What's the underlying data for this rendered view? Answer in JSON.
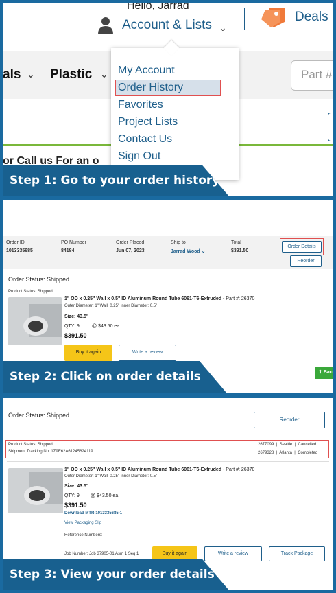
{
  "steps": {
    "step1": {
      "num": "Step 1:",
      "text": "Go to your order history"
    },
    "step2": {
      "num": "Step 2:",
      "text": "Click on order details"
    },
    "step3": {
      "num": "Step 3:",
      "text": "View your order details"
    }
  },
  "header": {
    "greeting": "Hello, Jarrad",
    "account_label": "Account & Lists",
    "deals_label": "Deals"
  },
  "nav": {
    "item_partial": "als",
    "item_plastic": "Plastic",
    "search_placeholder": "Part #,",
    "call_text": "or Call us For an o"
  },
  "account_menu": {
    "items": [
      "My Account",
      "Order History",
      "Favorites",
      "Project Lists",
      "Contact Us",
      "Sign Out"
    ]
  },
  "order": {
    "order_id_label": "Order ID",
    "order_id": "1013335685",
    "po_label": "PO Number",
    "po": "84184",
    "placed_label": "Order Placed",
    "placed": "Jun 07, 2023",
    "ship_label": "Ship to",
    "ship": "Jarrad Wood",
    "total_label": "Total",
    "total": "$391.50",
    "details_btn": "Order Details",
    "reorder_btn": "Reorder",
    "status_title": "Order Status: Shipped",
    "product_status": "Product Status: Shipped",
    "product_title": "1\" OD x 0.25\" Wall x 0.5\" ID Aluminum Round Tube 6061-T6-Extruded",
    "part_number": "- Part #: 26370",
    "specs": "Outer Diameter: 1\"   Wall: 0.25\"   Inner Diameter: 0.5\"",
    "size": "Size:  43.5\"",
    "qty": "QTY: 9",
    "unit_price": "@ $43.50 ea.",
    "unit_price2": "@ $43.50 ea",
    "line_total": "$391.50",
    "buy_again": "Buy it again",
    "write_review": "Write a review",
    "track_package": "Track Package",
    "back_label": "Bac",
    "tracking": "Shipment Tracking No. 1Z9E62A61245624119",
    "shipments": [
      {
        "id": "2677099",
        "city": "Seattle",
        "status": "Cancelled"
      },
      {
        "id": "2679328",
        "city": "Atlanta",
        "status": "Completed"
      }
    ],
    "download_mtr": "Download MTR-1013335685-1",
    "packing_slip": "View Packaging Slip",
    "reference_label": "Reference Numbers:",
    "job_number": "Job Number: Job 37905-01 Asm 1 Seq 1"
  },
  "colors": {
    "brand_blue": "#1f5f8b",
    "banner": "#18608f",
    "highlight_red": "#e05050",
    "buy_yellow": "#f5c518",
    "deals_orange": "#f07a3a"
  }
}
